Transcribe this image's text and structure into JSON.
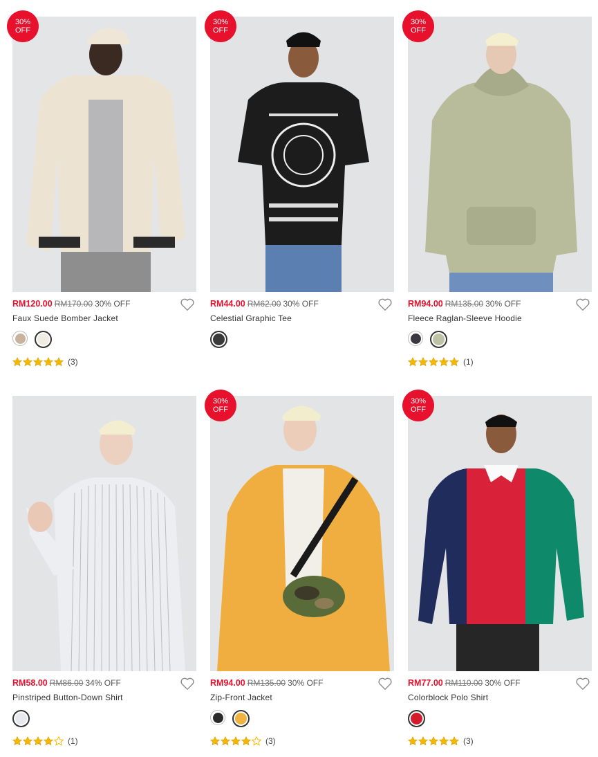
{
  "products": [
    {
      "name": "Faux Suede Bomber Jacket",
      "sale": "RM120.00",
      "orig": "RM170.00",
      "pct": "30% OFF",
      "badge": [
        "30%",
        "OFF"
      ],
      "swatches": [
        "#c9b39c",
        "#f1ece2"
      ],
      "selected": 1,
      "rating": 5,
      "reviews": "(3)"
    },
    {
      "name": "Celestial Graphic Tee",
      "sale": "RM44.00",
      "orig": "RM62.00",
      "pct": "30% OFF",
      "badge": [
        "30%",
        "OFF"
      ],
      "swatches": [
        "#3a3a3a"
      ],
      "selected": 0,
      "rating": 0,
      "reviews": ""
    },
    {
      "name": "Fleece Raglan-Sleeve Hoodie",
      "sale": "RM94.00",
      "orig": "RM135.00",
      "pct": "30% OFF",
      "badge": [
        "30%",
        "OFF"
      ],
      "swatches": [
        "#3b3842",
        "#bfc3a5"
      ],
      "selected": 1,
      "rating": 5,
      "reviews": "(1)"
    },
    {
      "name": "Pinstriped Button-Down Shirt",
      "sale": "RM58.00",
      "orig": "RM86.00",
      "pct": "34% OFF",
      "badge": null,
      "swatches": [
        "#e8e9ee"
      ],
      "selected": 0,
      "rating": 4,
      "reviews": "(1)"
    },
    {
      "name": "Zip-Front Jacket",
      "sale": "RM94.00",
      "orig": "RM135.00",
      "pct": "30% OFF",
      "badge": [
        "30%",
        "OFF"
      ],
      "swatches": [
        "#2a2a2a",
        "#f0b240"
      ],
      "selected": 1,
      "rating": 4,
      "reviews": "(3)"
    },
    {
      "name": "Colorblock Polo Shirt",
      "sale": "RM77.00",
      "orig": "RM110.00",
      "pct": "30% OFF",
      "badge": [
        "30%",
        "OFF"
      ],
      "swatches": [
        "#d41b2c"
      ],
      "selected": 0,
      "rating": 5,
      "reviews": "(3)"
    }
  ],
  "colors": {
    "sale": "#e8112d",
    "star": "#f5b800",
    "badge": "#e8112d"
  }
}
